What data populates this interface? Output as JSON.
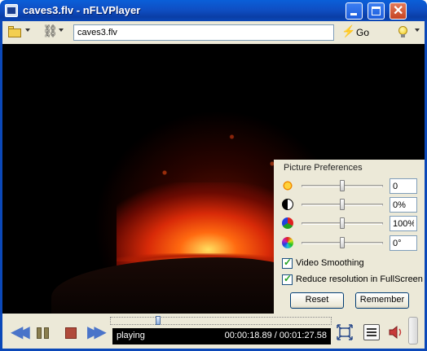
{
  "window": {
    "title": "caves3.flv - nFLVPlayer"
  },
  "toolbar": {
    "url_value": "caves3.flv",
    "go_label": "Go"
  },
  "prefs": {
    "title": "Picture Preferences",
    "brightness": {
      "value": "0",
      "level": 0.5
    },
    "contrast": {
      "value": "0%",
      "level": 0.5
    },
    "color": {
      "value": "100%",
      "level": 0.5
    },
    "hue": {
      "value": "0°",
      "level": 0.5
    },
    "video_smoothing": {
      "label": "Video Smoothing",
      "checked": true
    },
    "reduce_resolution": {
      "label": "Reduce resolution in FullScreen",
      "checked": true
    },
    "reset_label": "Reset",
    "remember_label": "Remember"
  },
  "player": {
    "state": "playing",
    "time": "00:00:18.89 / 00:01:27.58",
    "progress": 0.216
  },
  "colors": {
    "titlebar": "#0b48b8",
    "frame": "#ece9d8",
    "accent": "#4a74c9"
  }
}
